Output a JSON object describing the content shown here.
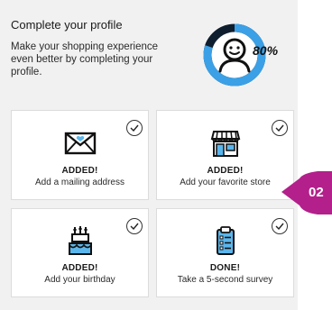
{
  "profile": {
    "title": "Complete your profile",
    "description": "Make your shopping experience even better by completing your profile.",
    "progress_percent": 80,
    "progress_label": "80%",
    "colors": {
      "progress_fill": "#3ba0e6",
      "progress_track": "#0f1e2e",
      "panel_bg": "#f1f1f1",
      "badge": "#b3208b"
    }
  },
  "cards": [
    {
      "status": "ADDED!",
      "label": "Add a mailing address",
      "icon": "envelope-heart-icon",
      "completed": true
    },
    {
      "status": "ADDED!",
      "label": "Add your favorite store",
      "icon": "store-icon",
      "completed": true
    },
    {
      "status": "ADDED!",
      "label": "Add your birthday",
      "icon": "birthday-cake-icon",
      "completed": true
    },
    {
      "status": "DONE!",
      "label": "Take a 5-second survey",
      "icon": "clipboard-survey-icon",
      "completed": true
    }
  ],
  "step_badge": {
    "label": "02"
  }
}
